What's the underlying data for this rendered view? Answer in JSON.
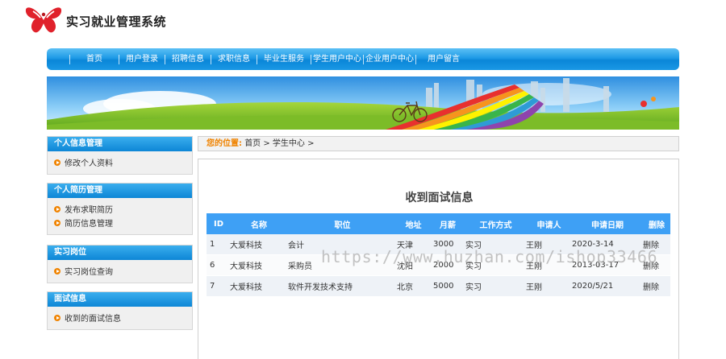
{
  "header": {
    "site_title": "实习就业管理系统"
  },
  "nav": {
    "items": [
      "首页",
      "用户登录",
      "招聘信息",
      "求职信息",
      "毕业生服务",
      "学生用户中心",
      "企业用户中心",
      "用户留言"
    ]
  },
  "sidebar": {
    "sections": [
      {
        "title": "个人信息管理",
        "links": [
          "修改个人资料"
        ]
      },
      {
        "title": "个人简历管理",
        "links": [
          "发布求职简历",
          "简历信息管理"
        ]
      },
      {
        "title": "实习岗位",
        "links": [
          "实习岗位查询"
        ]
      },
      {
        "title": "面试信息",
        "links": [
          "收到的面试信息"
        ]
      }
    ]
  },
  "breadcrumb": {
    "label": "您的位置:",
    "path": "首页 > 学生中心 >"
  },
  "content": {
    "title": "收到面试信息",
    "columns": [
      "ID",
      "名称",
      "职位",
      "地址",
      "月薪",
      "工作方式",
      "申请人",
      "申请日期",
      "删除"
    ],
    "rows": [
      [
        "1",
        "大爱科技",
        "会计",
        "天津",
        "3000",
        "实习",
        "王刚",
        "2020-3-14",
        "删除"
      ],
      [
        "6",
        "大爱科技",
        "采购员",
        "沈阳",
        "2000",
        "实习",
        "王刚",
        "2013-03-17",
        "删除"
      ],
      [
        "7",
        "大爱科技",
        "软件开发技术支持",
        "北京",
        "5000",
        "实习",
        "王刚",
        "2020/5/21",
        "删除"
      ]
    ]
  },
  "watermark": "https://www.huzhan.com/ishop33466",
  "colors": {
    "nav_blue": "#1e9ae6",
    "accent_orange": "#f08300",
    "table_head": "#3ea0f5"
  }
}
